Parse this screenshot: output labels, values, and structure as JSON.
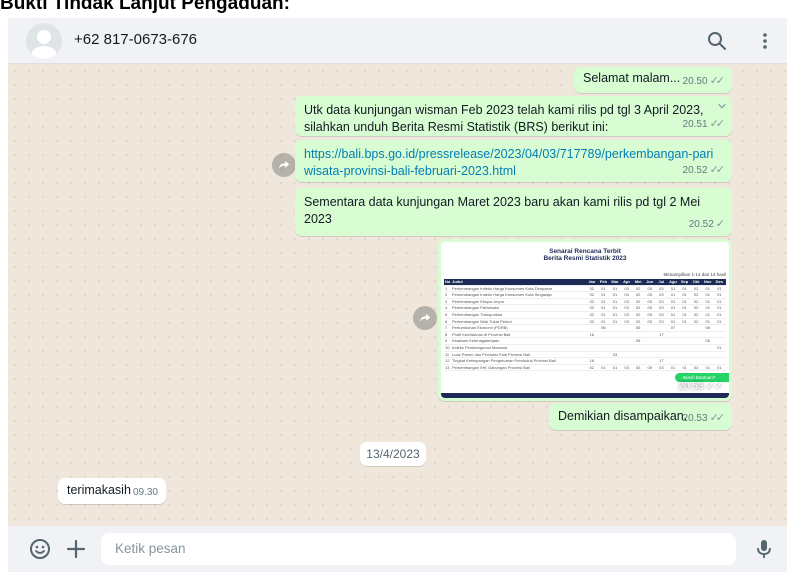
{
  "document": {
    "title": "Bukti Tindak Lanjut Pengaduan:"
  },
  "header": {
    "contact_name": "+62 817-0673-676"
  },
  "messages": [
    {
      "text": "Selamat malam...",
      "time": "20.50"
    },
    {
      "text": "Utk data kunjungan wisman Feb 2023 telah kami rilis pd tgl 3 April 2023, silahkan unduh Berita Resmi Statistik (BRS) berikut ini:",
      "time": "20.51"
    },
    {
      "text": "https://bali.bps.go.id/pressrelease/2023/04/03/717789/perkembangan-pariwisata-provinsi-bali-februari-2023.html",
      "time": "20.52"
    },
    {
      "text": "Sementara data kunjungan Maret 2023 baru akan kami rilis pd tgl 2 Mei 2023",
      "time": "20.52"
    },
    {
      "text": "Demikian disampaikan.",
      "time": "20.53"
    }
  ],
  "image_message": {
    "time": "20.53",
    "doc_title_1": "Senarai Rencana Terbit",
    "doc_title_2": "Berita Resmi Statistik 2023",
    "doc_note": "Menampilkan 1-14 dari 14 hasil",
    "badge": "Butuh Bantuan?",
    "table": {
      "headers": [
        "No",
        "Judul",
        "Jan",
        "Feb",
        "Mar",
        "Apr",
        "Mei",
        "Jun",
        "Jul",
        "Agu",
        "Sep",
        "Okt",
        "Nov",
        "Des"
      ],
      "rows": [
        [
          "1",
          "Perkembangan Indeks Harga Konsumen Kota Denpasar",
          "02",
          "01",
          "01",
          "03",
          "02",
          "05",
          "03",
          "01",
          "01",
          "02",
          "01",
          "01"
        ],
        [
          "2",
          "Perkembangan Indeks Harga Konsumen Kota Singaraja",
          "02",
          "01",
          "01",
          "03",
          "02",
          "05",
          "03",
          "01",
          "01",
          "02",
          "01",
          "01"
        ],
        [
          "3",
          "Perkembangan Ekspor-Impor",
          "02",
          "01",
          "01",
          "03",
          "02",
          "05",
          "03",
          "01",
          "01",
          "02",
          "01",
          "01"
        ],
        [
          "4",
          "Perkembangan Pariwisata",
          "02",
          "01",
          "01",
          "03",
          "02",
          "05",
          "03",
          "01",
          "01",
          "02",
          "01",
          "01"
        ],
        [
          "5",
          "Perkembangan Transportasi",
          "02",
          "01",
          "01",
          "03",
          "02",
          "05",
          "03",
          "01",
          "01",
          "02",
          "01",
          "01"
        ],
        [
          "6",
          "Perkembangan Nilai Tukar Petani",
          "02",
          "01",
          "01",
          "03",
          "02",
          "05",
          "03",
          "01",
          "01",
          "02",
          "01",
          "01"
        ],
        [
          "7",
          "Pertumbuhan Ekonomi (PDRB)",
          "",
          "06",
          "",
          "",
          "05",
          "",
          "",
          "07",
          "",
          "",
          "06",
          ""
        ],
        [
          "8",
          "Profil Kemiskinan di Provinsi Bali",
          "16",
          "",
          "",
          "",
          "",
          "",
          "17",
          "",
          "",
          "",
          "",
          ""
        ],
        [
          "9",
          "Keadaan Ketenagakerjaan",
          "",
          "",
          "",
          "",
          "05",
          "",
          "",
          "",
          "",
          "",
          "06",
          ""
        ],
        [
          "10",
          "Indeks Pembangunan Manusia",
          "",
          "",
          "",
          "",
          "",
          "",
          "",
          "",
          "",
          "",
          "",
          "01"
        ],
        [
          "11",
          "Luas Panen dan Produksi Padi Provinsi Bali",
          "",
          "",
          "03",
          "",
          "",
          "",
          "",
          "",
          "",
          "",
          "",
          ""
        ],
        [
          "12",
          "Tingkat Ketimpangan Pengeluaran Penduduk Provinsi Bali",
          "16",
          "",
          "",
          "",
          "",
          "",
          "17",
          "",
          "",
          "",
          "",
          ""
        ],
        [
          "13",
          "Perkembangan IHK Gabungan Provinsi Bali",
          "02",
          "01",
          "01",
          "03",
          "02",
          "05",
          "03",
          "01",
          "01",
          "02",
          "01",
          "01"
        ]
      ]
    }
  },
  "date_separator": "13/4/2023",
  "incoming": {
    "text": "terimakasih",
    "time": "09.30"
  },
  "composer": {
    "placeholder": "Ketik pesan"
  },
  "icons": {
    "search": "search-icon",
    "menu": "kebab-menu-icon",
    "emoji": "emoji-icon",
    "attach": "plus-icon",
    "mic": "microphone-icon",
    "forward": "forward-icon"
  }
}
